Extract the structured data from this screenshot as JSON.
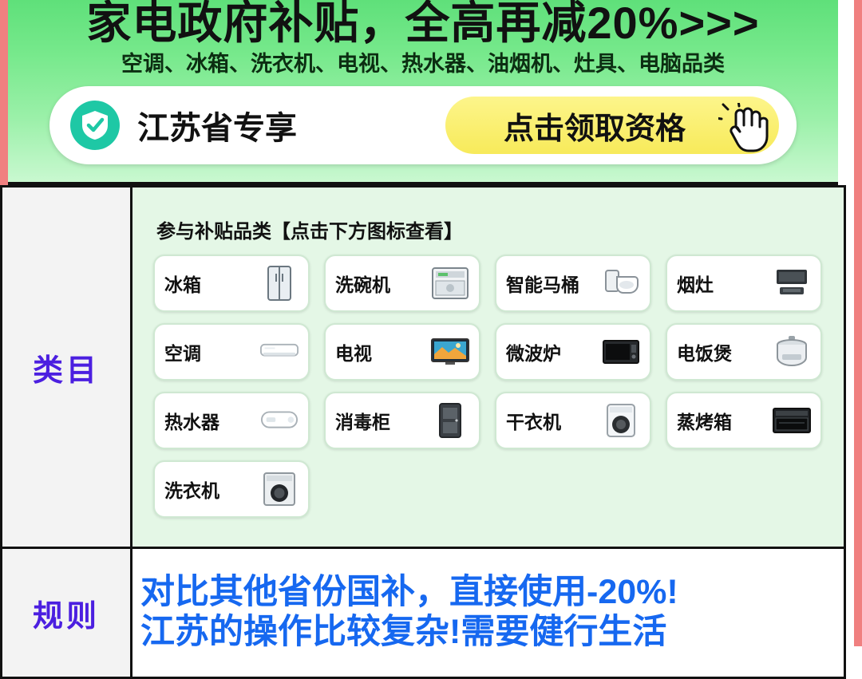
{
  "banner": {
    "title": "家电政府补贴，全高再减20%>>>",
    "subtitle": "空调、冰箱、洗衣机、电视、热水器、油烟机、灶具、电脑品类",
    "shield_icon": "shield-check-icon",
    "card_label": "江苏省专享",
    "cta_label": "点击领取资格",
    "cursor_icon": "hand-cursor-icon",
    "colors": {
      "banner_green": "#77e98c",
      "cta_yellow": "#f7ea5a",
      "shield_teal": "#1ec8a5"
    }
  },
  "table": {
    "rows": [
      {
        "label": "类目"
      },
      {
        "label": "规则"
      }
    ],
    "category": {
      "title": "参与补贴品类【点击下方图标查看】",
      "chips": [
        {
          "label": "冰箱",
          "icon": "refrigerator-icon"
        },
        {
          "label": "洗碗机",
          "icon": "dishwasher-icon"
        },
        {
          "label": "智能马桶",
          "icon": "smart-toilet-icon"
        },
        {
          "label": "烟灶",
          "icon": "range-hood-icon"
        },
        {
          "label": "空调",
          "icon": "air-conditioner-icon"
        },
        {
          "label": "电视",
          "icon": "television-icon"
        },
        {
          "label": "微波炉",
          "icon": "microwave-icon"
        },
        {
          "label": "电饭煲",
          "icon": "rice-cooker-icon"
        },
        {
          "label": "热水器",
          "icon": "water-heater-icon"
        },
        {
          "label": "消毒柜",
          "icon": "sterilizer-cabinet-icon"
        },
        {
          "label": "干衣机",
          "icon": "dryer-icon"
        },
        {
          "label": "蒸烤箱",
          "icon": "steam-oven-icon"
        },
        {
          "label": "洗衣机",
          "icon": "washing-machine-icon"
        }
      ]
    },
    "rule": {
      "line1": "对比其他省份国补，直接使用-20%!",
      "line2": "江苏的操作比较复杂!需要健行生活",
      "color": "#1668f0"
    }
  }
}
